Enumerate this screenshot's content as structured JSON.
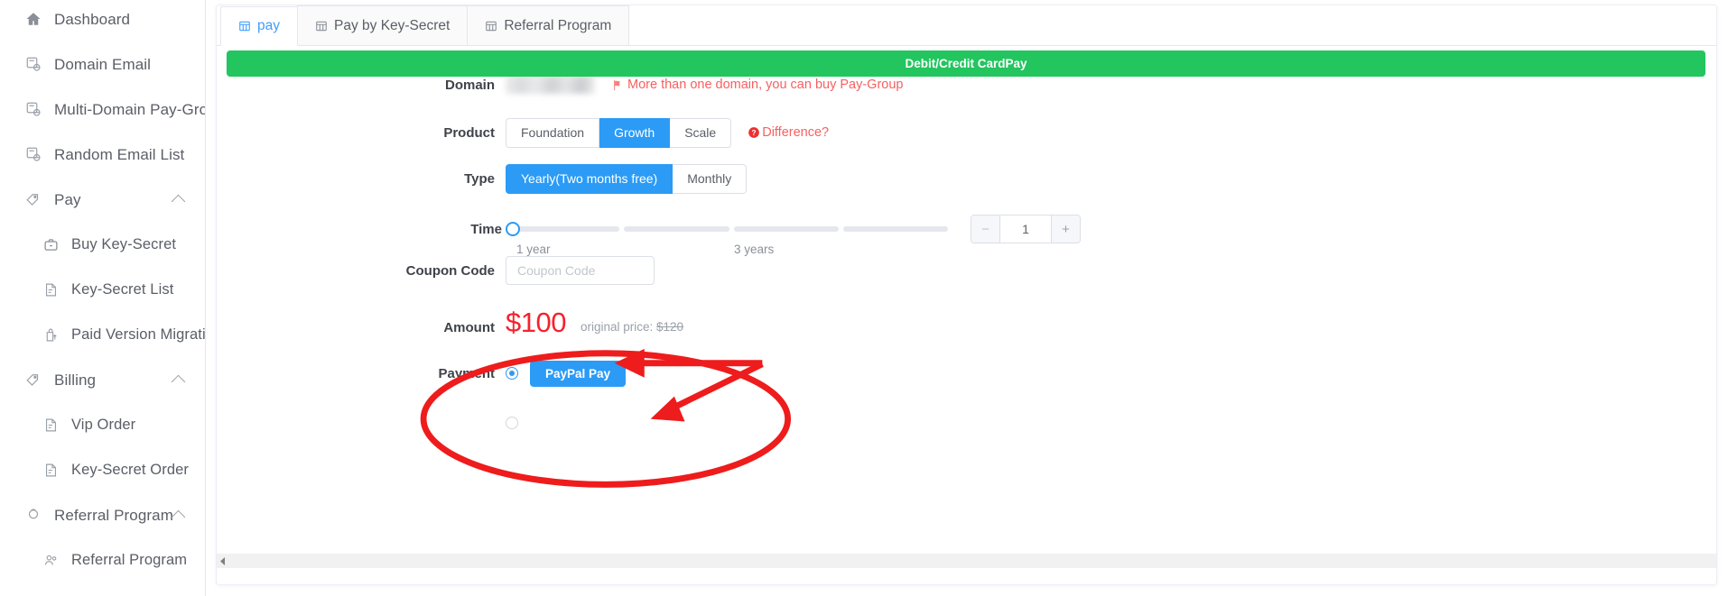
{
  "sidebar": {
    "items": [
      {
        "label": "Dashboard",
        "icon": "home-icon",
        "level": 0,
        "expandable": false
      },
      {
        "label": "Domain Email",
        "icon": "mail-domain-icon",
        "level": 0,
        "expandable": false
      },
      {
        "label": "Multi-Domain Pay-Group",
        "icon": "mail-domain-icon",
        "level": 0,
        "expandable": false
      },
      {
        "label": "Random Email List",
        "icon": "mail-domain-icon",
        "level": 0,
        "expandable": false
      },
      {
        "label": "Pay",
        "icon": "tag-icon",
        "level": 0,
        "expandable": true
      },
      {
        "label": "Buy Key-Secret",
        "icon": "briefcase-icon",
        "level": 1,
        "expandable": false
      },
      {
        "label": "Key-Secret List",
        "icon": "doc-key-icon",
        "level": 1,
        "expandable": false
      },
      {
        "label": "Paid Version Migration",
        "icon": "upgrade-icon",
        "level": 1,
        "expandable": false
      },
      {
        "label": "Billing",
        "icon": "tag-icon",
        "level": 0,
        "expandable": true
      },
      {
        "label": "Vip Order",
        "icon": "doc-key-icon",
        "level": 1,
        "expandable": false
      },
      {
        "label": "Key-Secret Order",
        "icon": "doc-key-icon",
        "level": 1,
        "expandable": false
      },
      {
        "label": "Referral Program",
        "icon": "share-icon",
        "level": 0,
        "expandable": true
      },
      {
        "label": "Referral Program",
        "icon": "people-icon",
        "level": 1,
        "expandable": false
      }
    ]
  },
  "tabs": [
    {
      "label": "pay",
      "icon": "table-icon",
      "active": true
    },
    {
      "label": "Pay by Key-Secret",
      "icon": "table-icon",
      "active": false
    },
    {
      "label": "Referral Program",
      "icon": "table-icon",
      "active": false
    }
  ],
  "form": {
    "domain": {
      "label": "Domain",
      "value": "",
      "redacted": true,
      "warning": "More than one domain, you can buy Pay-Group",
      "warning_icon": "flag-icon"
    },
    "product": {
      "label": "Product",
      "options": [
        "Foundation",
        "Growth",
        "Scale"
      ],
      "selected": "Growth",
      "difference_link": "Difference?",
      "difference_icon": "question-circle-icon"
    },
    "type": {
      "label": "Type",
      "options": [
        "Yearly(Two months free)",
        "Monthly"
      ],
      "selected": "Yearly(Two months free)"
    },
    "time": {
      "label": "Time",
      "min_mark": "1 year",
      "max_mark": "3 years",
      "segments": 4,
      "knob_position_percent": 0,
      "stepper_value": "1",
      "minus_label": "−",
      "plus_label": "+"
    },
    "coupon": {
      "label": "Coupon Code",
      "placeholder": "Coupon Code",
      "value": ""
    },
    "amount": {
      "label": "Amount",
      "value": "$100",
      "original_price_prefix": "original price:",
      "original_price": "$120"
    },
    "payment": {
      "label": "Payment",
      "methods": [
        {
          "label": "PayPal Pay",
          "selected": true,
          "color": "#2b9bf6"
        },
        {
          "label": "Debit/Credit CardPay",
          "selected": false,
          "color": "#22c55e"
        }
      ]
    }
  },
  "annotations": {
    "highlight_color": "#ee1c1c",
    "ellipse": true,
    "arrows": 2
  },
  "colors": {
    "primary": "#2b9bf6",
    "danger": "#f95f5f",
    "amount": "#f5222d",
    "success": "#22c55e",
    "annotation": "#ee1c1c"
  }
}
